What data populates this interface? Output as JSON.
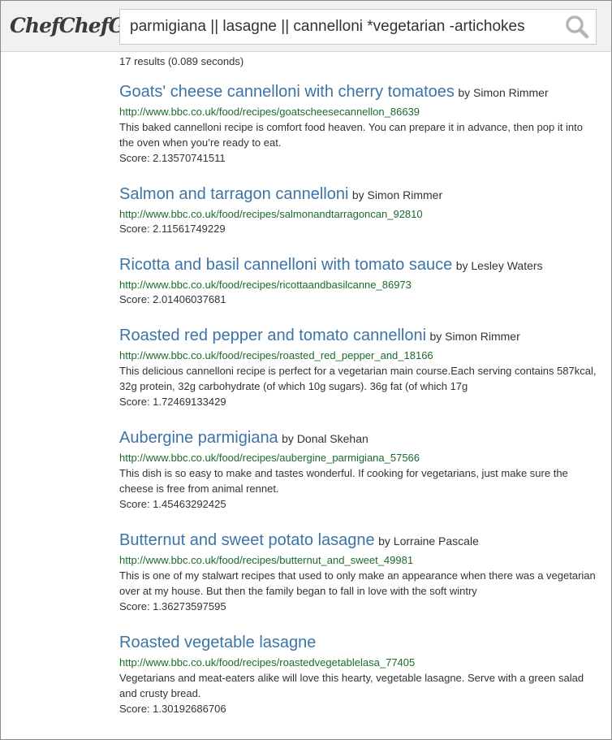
{
  "app": {
    "logo": "ChefChefGo"
  },
  "search": {
    "query": "parmigiana || lasagne || cannelloni *vegetarian -artichokes"
  },
  "summary": {
    "result_count": "17 results (0.089 seconds)"
  },
  "results": [
    {
      "title": "Goats' cheese cannelloni with cherry tomatoes",
      "author": "by Simon Rimmer",
      "url": "http://www.bbc.co.uk/food/recipes/goatscheesecannellon_86639",
      "description": "This baked cannelloni recipe is comfort food heaven. You can prepare it in advance, then pop it into the oven when you’re ready to eat.",
      "score": "Score: 2.13570741511"
    },
    {
      "title": "Salmon and tarragon cannelloni",
      "author": "by Simon Rimmer",
      "url": "http://www.bbc.co.uk/food/recipes/salmonandtarragoncan_92810",
      "description": "",
      "score": "Score: 2.11561749229"
    },
    {
      "title": "Ricotta and basil cannelloni with tomato sauce",
      "author": "by Lesley Waters",
      "url": "http://www.bbc.co.uk/food/recipes/ricottaandbasilcanne_86973",
      "description": "",
      "score": "Score: 2.01406037681"
    },
    {
      "title": "Roasted red pepper and tomato cannelloni",
      "author": "by Simon Rimmer",
      "url": "http://www.bbc.co.uk/food/recipes/roasted_red_pepper_and_18166",
      "description": "This delicious cannelloni recipe is perfect for a vegetarian main course.Each serving contains 587kcal, 32g protein, 32g carbohydrate (of which 10g sugars). 36g fat (of which 17g",
      "score": "Score: 1.72469133429"
    },
    {
      "title": "Aubergine parmigiana",
      "author": "by Donal Skehan",
      "url": "http://www.bbc.co.uk/food/recipes/aubergine_parmigiana_57566",
      "description": "This dish is so easy to make and tastes wonderful. If cooking for vegetarians, just make sure the cheese is free from animal rennet.",
      "score": "Score: 1.45463292425"
    },
    {
      "title": "Butternut and sweet potato lasagne",
      "author": "by Lorraine Pascale",
      "url": "http://www.bbc.co.uk/food/recipes/butternut_and_sweet_49981",
      "description": "This is one of my stalwart recipes that used to only make an appearance when there was a vegetarian over at my house. But then the family began to fall in love with the soft wintry",
      "score": "Score: 1.36273597595"
    },
    {
      "title": "Roasted vegetable lasagne",
      "author": "",
      "url": "http://www.bbc.co.uk/food/recipes/roastedvegetablelasa_77405",
      "description": "Vegetarians and meat-eaters alike will love this hearty, vegetable lasagne. Serve with a green salad and crusty bread.",
      "score": "Score: 1.30192686706"
    }
  ],
  "colors": {
    "title_link": "#3c74a8",
    "url": "#1a6b2c",
    "header_bg": "#f1f1f1"
  },
  "icons": {
    "search_button": "search-icon"
  }
}
